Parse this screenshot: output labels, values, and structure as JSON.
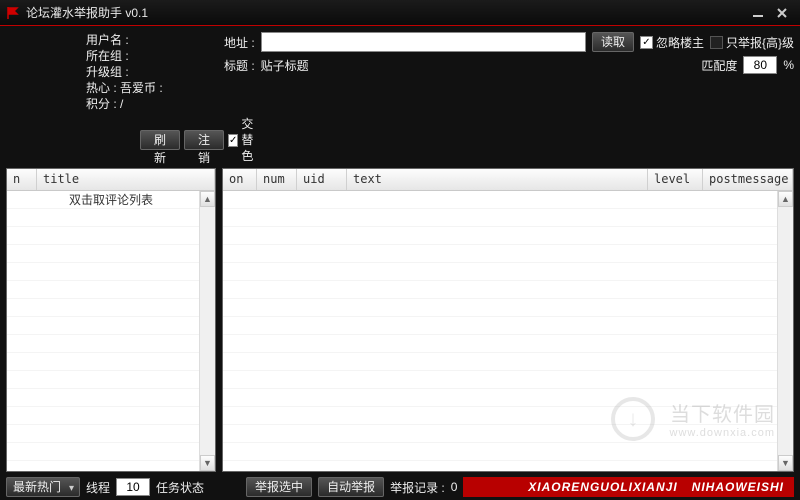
{
  "title": "论坛灌水举报助手  v0.1",
  "user": {
    "name_lbl": "用户名 :",
    "group_lbl": "所在组 :",
    "upgrade_lbl": "升级组 :",
    "hot_lbl": "热心 :",
    "coin_lbl": "吾爱币 :",
    "score_lbl": "积分 : /",
    "refresh": "刷新",
    "logout": "注销",
    "alt_color": "交替色"
  },
  "addr": {
    "label": "地址 :",
    "value": "",
    "read": "读取",
    "skip_op": "忽略楼主",
    "only_high": "只举报{高}级"
  },
  "titleline": {
    "label": "标题 :",
    "value": "贴子标题",
    "match_lbl": "匹配度",
    "match_val": "80",
    "pct": "%"
  },
  "left_grid": {
    "cols": [
      "n",
      "title"
    ],
    "placeholder": "双击取评论列表"
  },
  "right_grid": {
    "cols": [
      "on",
      "num",
      "uid",
      "text",
      "level",
      "postmessage"
    ]
  },
  "bottom": {
    "hot_latest": "最新热门",
    "threads_lbl": "线程",
    "threads_val": "10",
    "status_lbl": "任务状态",
    "status_val": "",
    "report_sel": "举报选中",
    "auto_report": "自动举报",
    "record_lbl": "举报记录 :",
    "record_val": "0",
    "banner1": "XIAORENGUOLIXIANJI",
    "banner2": "NIHAOWEISHI"
  },
  "watermark": {
    "ch": "当下软件园",
    "en": "www.downxia.com",
    "arrow": "↓"
  }
}
